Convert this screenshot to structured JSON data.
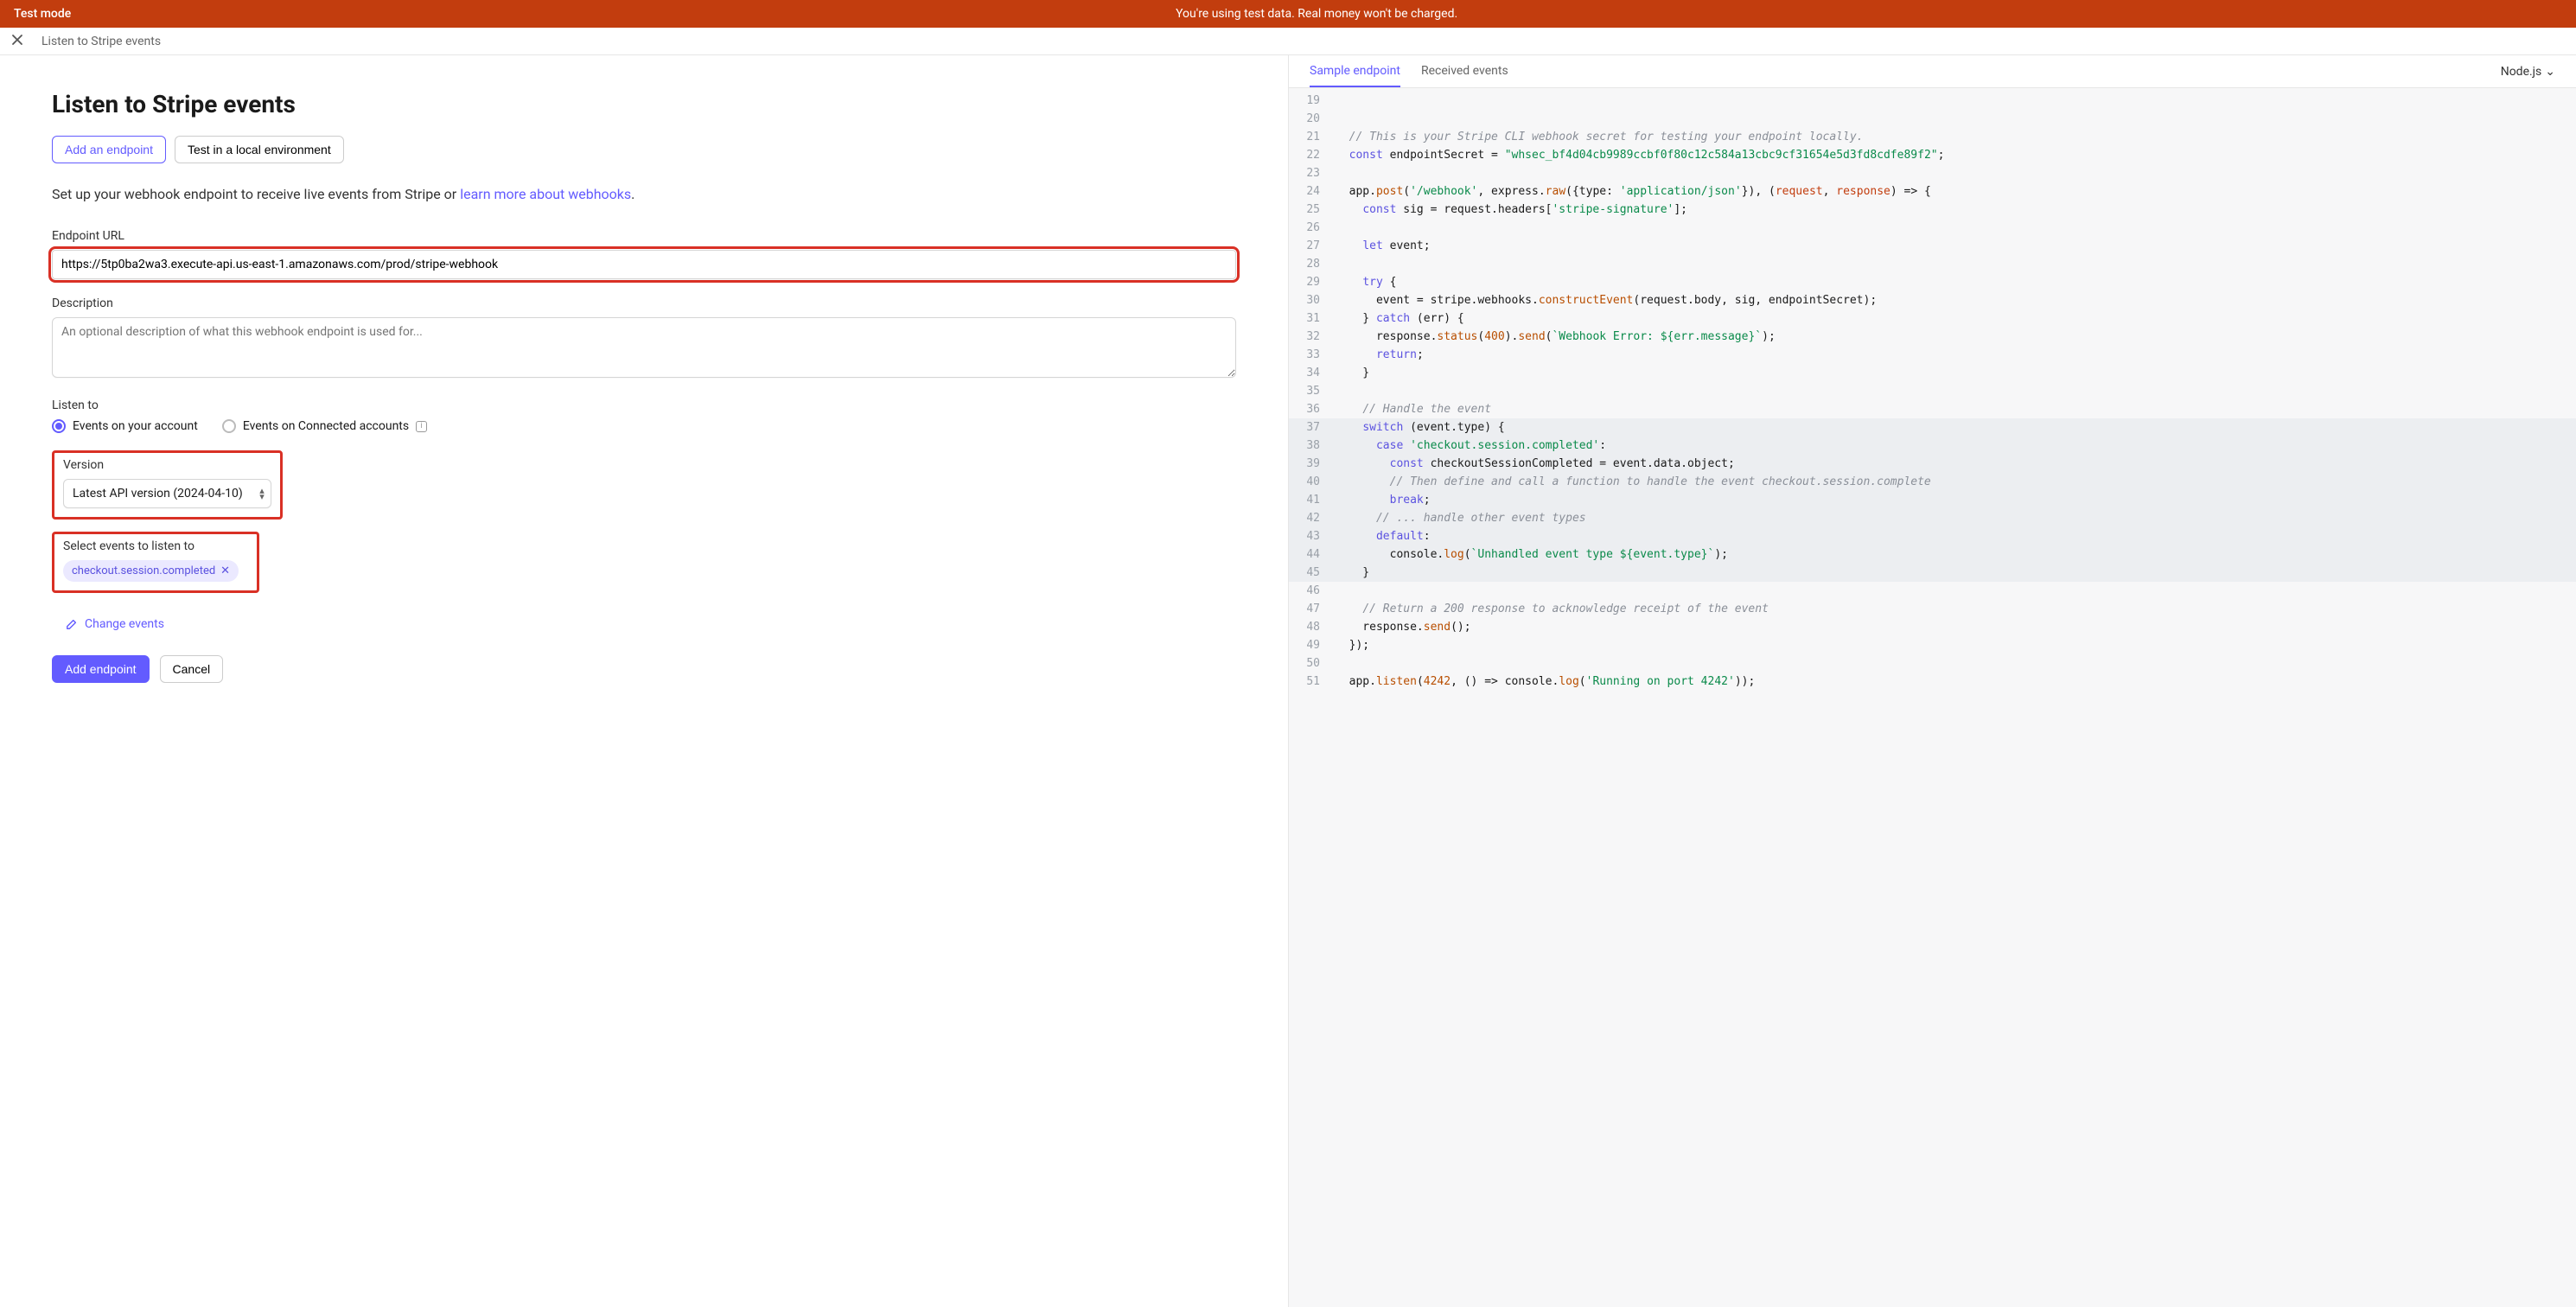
{
  "banner": {
    "mode": "Test mode",
    "message": "You're using test data. Real money won't be charged."
  },
  "topbar": {
    "title": "Listen to Stripe events"
  },
  "left": {
    "heading": "Listen to Stripe events",
    "add_endpoint_btn": "Add an endpoint",
    "test_local_btn": "Test in a local environment",
    "intro_prefix": "Set up your webhook endpoint to receive live events from Stripe or ",
    "intro_link": "learn more about webhooks",
    "intro_suffix": ".",
    "endpoint_label": "Endpoint URL",
    "endpoint_value": "https://5tp0ba2wa3.execute-api.us-east-1.amazonaws.com/prod/stripe-webhook",
    "description_label": "Description",
    "description_placeholder": "An optional description of what this webhook endpoint is used for...",
    "listen_to_label": "Listen to",
    "radio1": "Events on your account",
    "radio2": "Events on Connected accounts",
    "version_label": "Version",
    "version_value": "Latest API version (2024-04-10)",
    "select_events_label": "Select events to listen to",
    "event_chip": "checkout.session.completed",
    "change_events": "Change events",
    "submit": "Add endpoint",
    "cancel": "Cancel"
  },
  "right": {
    "tabs": {
      "sample": "Sample endpoint",
      "received": "Received events"
    },
    "language": "Node.js",
    "code": [
      {
        "n": 19,
        "hl": false,
        "html": ""
      },
      {
        "n": 20,
        "hl": false,
        "html": ""
      },
      {
        "n": 21,
        "hl": false,
        "html": "  <span class='c-comment'>// This is your Stripe CLI webhook secret for testing your endpoint locally.</span>"
      },
      {
        "n": 22,
        "hl": false,
        "html": "  <span class='c-kw'>const</span> endpointSecret = <span class='c-str'>\"whsec_bf4d04cb9989ccbf0f80c12c584a13cbc9cf31654e5d3fd8cdfe89f2\"</span>;"
      },
      {
        "n": 23,
        "hl": false,
        "html": ""
      },
      {
        "n": 24,
        "hl": false,
        "html": "  app.<span class='c-fn'>post</span>(<span class='c-str'>'/webhook'</span>, express.<span class='c-fn'>raw</span>({type: <span class='c-str'>'application/json'</span>}), (<span class='c-req'>request</span>, <span class='c-req'>response</span>) => {"
      },
      {
        "n": 25,
        "hl": false,
        "html": "    <span class='c-kw'>const</span> sig = request.headers[<span class='c-str'>'stripe-signature'</span>];"
      },
      {
        "n": 26,
        "hl": false,
        "html": ""
      },
      {
        "n": 27,
        "hl": false,
        "html": "    <span class='c-kw'>let</span> event;"
      },
      {
        "n": 28,
        "hl": false,
        "html": ""
      },
      {
        "n": 29,
        "hl": false,
        "html": "    <span class='c-kw'>try</span> {"
      },
      {
        "n": 30,
        "hl": false,
        "html": "      event = stripe.webhooks.<span class='c-fn'>constructEvent</span>(request.body, sig, endpointSecret);"
      },
      {
        "n": 31,
        "hl": false,
        "html": "    } <span class='c-kw'>catch</span> (err) {"
      },
      {
        "n": 32,
        "hl": false,
        "html": "      response.<span class='c-fn'>status</span>(<span class='c-num'>400</span>).<span class='c-fn'>send</span>(<span class='c-str'>`Webhook Error: ${err.message}`</span>);"
      },
      {
        "n": 33,
        "hl": false,
        "html": "      <span class='c-kw'>return</span>;"
      },
      {
        "n": 34,
        "hl": false,
        "html": "    }"
      },
      {
        "n": 35,
        "hl": false,
        "html": ""
      },
      {
        "n": 36,
        "hl": false,
        "html": "    <span class='c-comment'>// Handle the event</span>"
      },
      {
        "n": 37,
        "hl": true,
        "html": "    <span class='c-kw'>switch</span> (event.type) {"
      },
      {
        "n": 38,
        "hl": true,
        "html": "      <span class='c-kw'>case</span> <span class='c-str'>'checkout.session.completed'</span>:"
      },
      {
        "n": 39,
        "hl": true,
        "html": "        <span class='c-kw'>const</span> checkoutSessionCompleted = event.data.object;"
      },
      {
        "n": 40,
        "hl": true,
        "html": "        <span class='c-comment'>// Then define and call a function to handle the event checkout.session.complete</span>"
      },
      {
        "n": 41,
        "hl": true,
        "html": "        <span class='c-kw'>break</span>;"
      },
      {
        "n": 42,
        "hl": true,
        "html": "      <span class='c-comment'>// ... handle other event types</span>"
      },
      {
        "n": 43,
        "hl": true,
        "html": "      <span class='c-kw'>default</span>:"
      },
      {
        "n": 44,
        "hl": true,
        "html": "        console.<span class='c-fn'>log</span>(<span class='c-str'>`Unhandled event type ${event.type}`</span>);"
      },
      {
        "n": 45,
        "hl": true,
        "html": "    }"
      },
      {
        "n": 46,
        "hl": false,
        "html": ""
      },
      {
        "n": 47,
        "hl": false,
        "html": "    <span class='c-comment'>// Return a 200 response to acknowledge receipt of the event</span>"
      },
      {
        "n": 48,
        "hl": false,
        "html": "    response.<span class='c-fn'>send</span>();"
      },
      {
        "n": 49,
        "hl": false,
        "html": "  });"
      },
      {
        "n": 50,
        "hl": false,
        "html": ""
      },
      {
        "n": 51,
        "hl": false,
        "html": "  app.<span class='c-fn'>listen</span>(<span class='c-num'>4242</span>, () => console.<span class='c-fn'>log</span>(<span class='c-str'>'Running on port 4242'</span>));"
      }
    ]
  }
}
